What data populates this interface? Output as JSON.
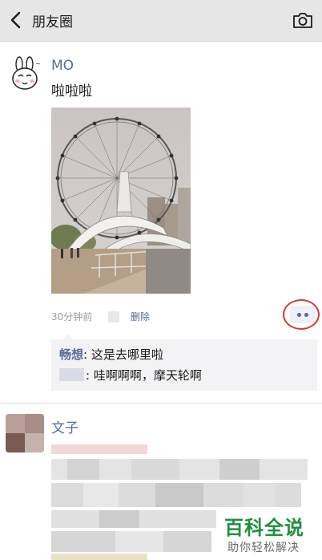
{
  "nav": {
    "title": "朋友圈",
    "back_icon": "chevron-left-icon",
    "camera_icon": "camera-icon"
  },
  "post1": {
    "author": "MO",
    "text": "啦啦啦",
    "time": "30分钟前",
    "delete_label": "删除",
    "comments": [
      {
        "user": "畅想",
        "sep": ": ",
        "text": "这是去哪里啦"
      },
      {
        "user": "",
        "sep": ": ",
        "text": "哇啊啊啊，摩天轮啊"
      }
    ]
  },
  "post2": {
    "author": "文子"
  },
  "watermark": {
    "title": "百科全说",
    "subtitle": "助你轻松解决"
  },
  "colors": {
    "link": "#576b95",
    "highlight_ring": "#d33b3b",
    "watermark_green": "#1f8f3f"
  }
}
